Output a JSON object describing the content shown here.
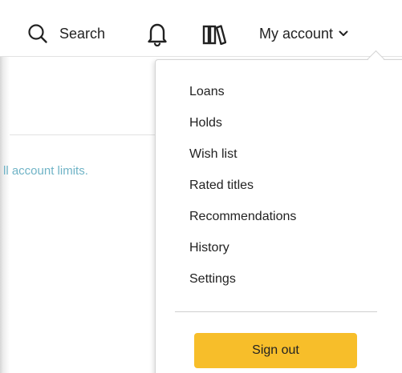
{
  "header": {
    "search_label": "Search",
    "account_label": "My account"
  },
  "content": {
    "limits_link_text": "ll account limits."
  },
  "account_menu": {
    "items": [
      {
        "label": "Loans"
      },
      {
        "label": "Holds"
      },
      {
        "label": "Wish list"
      },
      {
        "label": "Rated titles"
      },
      {
        "label": "Recommendations"
      },
      {
        "label": "History"
      },
      {
        "label": "Settings"
      }
    ],
    "sign_out_label": "Sign out"
  },
  "colors": {
    "link": "#6fb3c6",
    "sign_out_button": "#f7be2a"
  },
  "icons": {
    "search": "search-icon",
    "notifications": "bell-icon",
    "library": "books-icon",
    "dropdown": "chevron-down-icon"
  }
}
